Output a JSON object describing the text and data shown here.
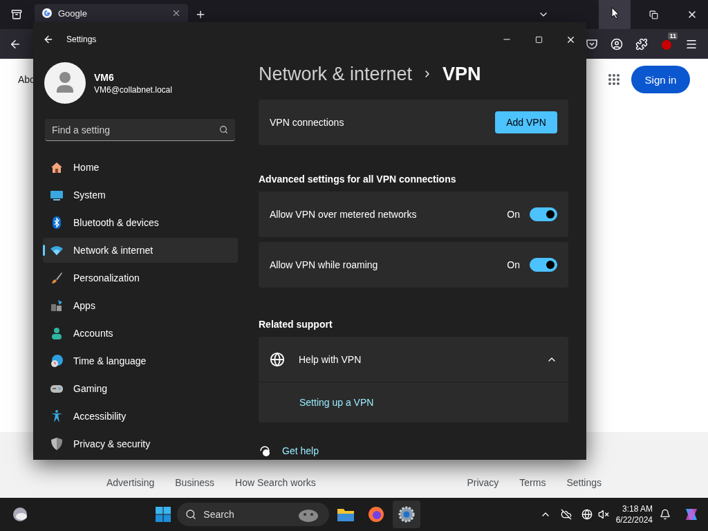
{
  "browser": {
    "tabs": [
      {
        "title": "Google",
        "selected": true
      }
    ],
    "extension_badge": "11",
    "page": {
      "partial_link": "Abo",
      "sign_in": "Sign in",
      "footer_left": [
        "Advertising",
        "Business",
        "How Search works"
      ],
      "footer_right": [
        "Privacy",
        "Terms",
        "Settings"
      ]
    }
  },
  "settings": {
    "title": "Settings",
    "user": {
      "name": "VM6",
      "email": "VM6@collabnet.local"
    },
    "search": {
      "placeholder": "Find a setting"
    },
    "nav": [
      {
        "label": "Home",
        "selected": false
      },
      {
        "label": "System",
        "selected": false
      },
      {
        "label": "Bluetooth & devices",
        "selected": false
      },
      {
        "label": "Network & internet",
        "selected": true
      },
      {
        "label": "Personalization",
        "selected": false
      },
      {
        "label": "Apps",
        "selected": false
      },
      {
        "label": "Accounts",
        "selected": false
      },
      {
        "label": "Time & language",
        "selected": false
      },
      {
        "label": "Gaming",
        "selected": false
      },
      {
        "label": "Accessibility",
        "selected": false
      },
      {
        "label": "Privacy & security",
        "selected": false
      }
    ],
    "breadcrumb": [
      "Network & internet",
      "VPN"
    ],
    "vpn_connections": {
      "label": "VPN connections",
      "button": "Add VPN"
    },
    "advanced_heading": "Advanced settings for all VPN connections",
    "toggles": [
      {
        "label": "Allow VPN over metered networks",
        "state_text": "On",
        "on": true
      },
      {
        "label": "Allow VPN while roaming",
        "state_text": "On",
        "on": true
      }
    ],
    "related_heading": "Related support",
    "help": {
      "title": "Help with VPN",
      "expanded": true,
      "links": [
        "Setting up a VPN"
      ]
    },
    "get_help": "Get help"
  },
  "taskbar": {
    "search_placeholder": "Search",
    "time": "3:18 AM",
    "date": "6/22/2024"
  }
}
